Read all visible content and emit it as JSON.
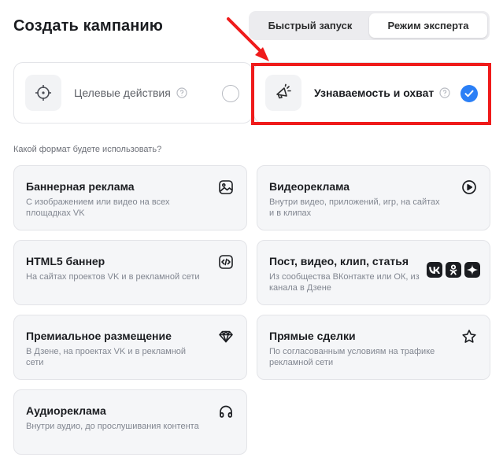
{
  "header": {
    "title": "Создать кампанию",
    "mode_tabs": [
      {
        "label": "Быстрый запуск",
        "active": false
      },
      {
        "label": "Режим эксперта",
        "active": true
      }
    ]
  },
  "goals": [
    {
      "label": "Целевые действия",
      "icon": "target-icon",
      "selected": false
    },
    {
      "label": "Узнаваемость и охват",
      "icon": "megaphone-icon",
      "selected": true
    }
  ],
  "format_section": {
    "question": "Какой формат будете использовать?"
  },
  "formats": [
    {
      "title": "Баннерная реклама",
      "description": "С изображением или видео на всех площадках VK",
      "icon": "image-icon"
    },
    {
      "title": "Видеореклама",
      "description": "Внутри видео, приложений, игр, на сайтах и в клипах",
      "icon": "play-icon"
    },
    {
      "title": "HTML5 баннер",
      "description": "На сайтах проектов VK и в рекламной сети",
      "icon": "html5-icon"
    },
    {
      "title": "Пост, видео, клип, статья",
      "description": "Из сообщества ВКонтакте или ОК, из канала в Дзене",
      "icon": "social-icons"
    },
    {
      "title": "Премиальное размещение",
      "description": "В Дзене, на проектах VK и в рекламной сети",
      "icon": "diamond-icon"
    },
    {
      "title": "Прямые сделки",
      "description": "По согласованным условиям на трафике рекламной сети",
      "icon": "star-icon"
    },
    {
      "title": "Аудиореклама",
      "description": "Внутри аудио, до прослушивания контента",
      "icon": "headphones-icon"
    }
  ],
  "colors": {
    "accent": "#2b7ff6",
    "highlight": "#ef1b1b",
    "card_background": "#f5f6f8"
  }
}
